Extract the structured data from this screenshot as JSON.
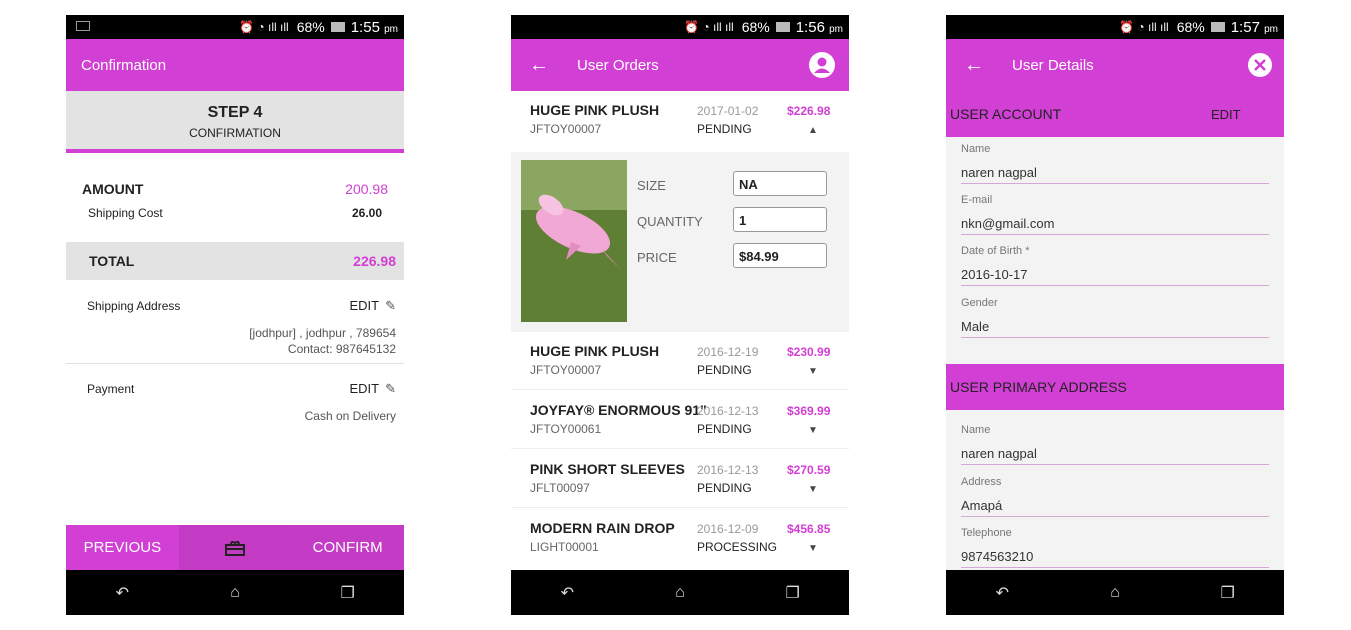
{
  "status": {
    "battery": "68%",
    "screens": [
      {
        "time": "1:55",
        "ampm": "pm"
      },
      {
        "time": "1:56",
        "ampm": "pm"
      },
      {
        "time": "1:57",
        "ampm": "pm"
      }
    ]
  },
  "colors": {
    "accent": "#d23fd4",
    "accent_dark": "#c33bc5",
    "gray": "#e3e3e3"
  },
  "confirmation": {
    "title": "Confirmation",
    "step_title": "STEP 4",
    "step_subtitle": "CONFIRMATION",
    "amount_label": "AMOUNT",
    "amount_value": "200.98",
    "shipping_label": "Shipping Cost",
    "shipping_value": "26.00",
    "total_label": "TOTAL",
    "total_value": "226.98",
    "shipping_address_label": "Shipping Address",
    "edit_label": "EDIT",
    "address_line": "[jodhpur] , jodhpur , 789654",
    "contact_line": "Contact: 987645132",
    "payment_label": "Payment",
    "payment_value": "Cash on Delivery",
    "previous_label": "PREVIOUS",
    "confirm_label": "CONFIRM"
  },
  "orders": {
    "title": "User Orders",
    "expanded": {
      "name": "HUGE PINK PLUSH",
      "code": "JFTOY00007",
      "date": "2017-01-02",
      "status": "PENDING",
      "price": "$226.98",
      "size_label": "SIZE",
      "size_value": "NA",
      "quantity_label": "QUANTITY",
      "quantity_value": "1",
      "price_label": "PRICE",
      "price_value": "$84.99"
    },
    "list": [
      {
        "name": "HUGE PINK PLUSH",
        "code": "JFTOY00007",
        "date": "2016-12-19",
        "status": "PENDING",
        "price": "$230.99"
      },
      {
        "name": "JOYFAY® ENORMOUS 91\"",
        "code": "JFTOY00061",
        "date": "2016-12-13",
        "status": "PENDING",
        "price": "$369.99"
      },
      {
        "name": "PINK SHORT SLEEVES",
        "code": "JFLT00097",
        "date": "2016-12-13",
        "status": "PENDING",
        "price": "$270.59"
      },
      {
        "name": "MODERN RAIN DROP",
        "code": "LIGHT00001",
        "date": "2016-12-09",
        "status": "PROCESSING",
        "price": "$456.85"
      }
    ]
  },
  "user": {
    "title": "User Details",
    "account_header": "USER ACCOUNT",
    "edit_label": "EDIT",
    "account_fields": [
      {
        "label": "Name",
        "value": "naren nagpal"
      },
      {
        "label": "E-mail",
        "value": "nkn@gmail.com"
      },
      {
        "label": "Date of Birth *",
        "value": "2016-10-17"
      },
      {
        "label": "Gender",
        "value": "Male"
      }
    ],
    "address_header": "USER PRIMARY ADDRESS",
    "address_fields": [
      {
        "label": "Name",
        "value": "naren nagpal"
      },
      {
        "label": "Address",
        "value": "Amapá"
      },
      {
        "label": "Telephone",
        "value": "9874563210"
      }
    ]
  },
  "nav": {
    "back_glyph": "↶",
    "home_glyph": "⌂",
    "recents_glyph": "❐"
  }
}
